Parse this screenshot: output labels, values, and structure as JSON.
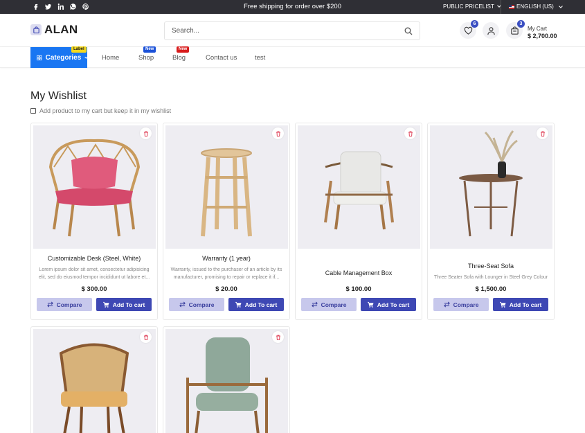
{
  "topbar": {
    "social_icons": [
      "facebook-icon",
      "twitter-icon",
      "linkedin-icon",
      "whatsapp-icon",
      "pinterest-icon"
    ],
    "shipping_text": "Free shipping for order over $200",
    "pricelist": "PUBLIC PRICELIST",
    "language": "ENGLISH (US)"
  },
  "header": {
    "logo_text": "ALAN",
    "search_placeholder": "Search...",
    "wishlist_count": "6",
    "cart_count": "3",
    "cart_label": "My Cart",
    "cart_total": "$ 2,700.00"
  },
  "nav": {
    "categories_label": "Categories",
    "categories_tag": "Label",
    "items": [
      {
        "label": "Home"
      },
      {
        "label": "Shop",
        "tag": "New"
      },
      {
        "label": "Blog",
        "tag": "New"
      },
      {
        "label": "Contact us"
      },
      {
        "label": "test"
      }
    ]
  },
  "main": {
    "title": "My Wishlist",
    "keep_label": "Add product to my cart but keep it in my wishlist",
    "compare_label": "Compare",
    "add_to_cart_label": "Add To cart"
  },
  "products": [
    {
      "name": "Customizable Desk (Steel, White)",
      "desc": "Lorem ipsum dolor sit amet, consectetur adipisicing elit, sed do eiusmod tempor incididunt ut labore et...",
      "price": "$ 300.00"
    },
    {
      "name": "Warranty (1 year)",
      "desc": "Warranty, issued to the purchaser of an article by its manufacturer, promising to repair or replace it if...",
      "price": "$ 20.00"
    },
    {
      "name": "Cable Management Box",
      "desc": "",
      "price": "$ 100.00"
    },
    {
      "name": "Three-Seat Sofa",
      "desc": "Three Seater Sofa with Lounger in Steel Grey Colour",
      "price": "$ 1,500.00"
    },
    {
      "name": "",
      "desc": "",
      "price": ""
    },
    {
      "name": "",
      "desc": "",
      "price": ""
    }
  ],
  "colors": {
    "topbar_bg": "#2f2f35",
    "primary": "#3e48b4",
    "nav_accent": "#1976f2",
    "compare_bg": "#c7c8ec"
  }
}
